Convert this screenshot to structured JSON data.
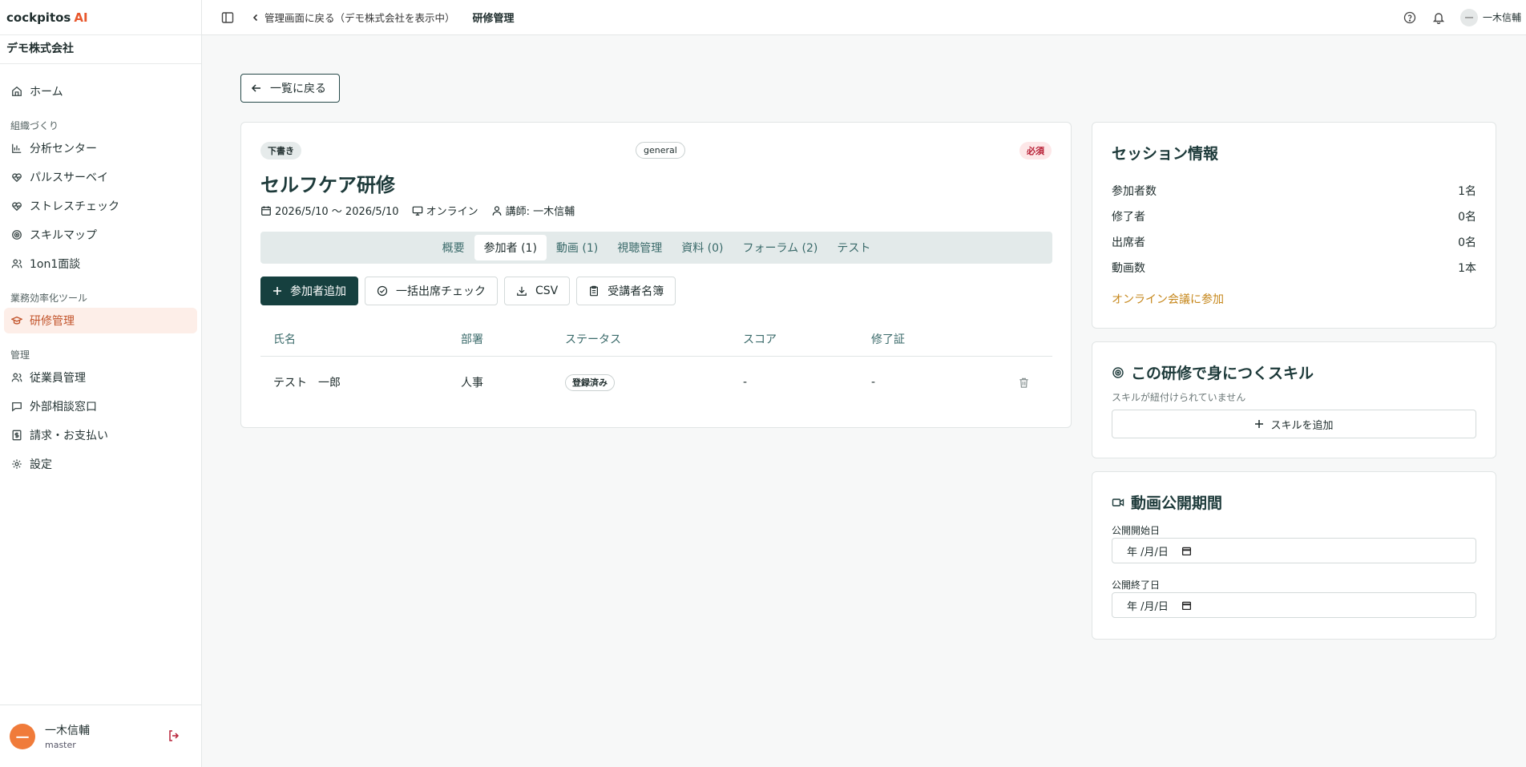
{
  "brand": {
    "name": "cockpitos",
    "suffix": "AI"
  },
  "company": "デモ株式会社",
  "sidebar": {
    "home": "ホーム",
    "section1": "組織づくり",
    "org_items": [
      "分析センター",
      "パルスサーベイ",
      "ストレスチェック",
      "スキルマップ",
      "1on1面談"
    ],
    "section2": "業務効率化ツール",
    "tools_items": [
      "研修管理"
    ],
    "section3": "管理",
    "admin_items": [
      "従業員管理",
      "外部相談窓口",
      "請求・お支払い",
      "設定"
    ]
  },
  "user": {
    "initial": "一",
    "name": "一木信輔",
    "role": "master"
  },
  "topbar": {
    "back_label": "管理画面に戻る（デモ株式会社を表示中）",
    "title": "研修管理",
    "user_initial": "一",
    "user_name": "一木信輔"
  },
  "back_button": "一覧に戻る",
  "course": {
    "status_badge": "下書き",
    "category": "general",
    "required_badge": "必須",
    "title": "セルフケア研修",
    "date_range": "2026/5/10 〜 2026/5/10",
    "mode": "オンライン",
    "instructor": "講師: 一木信輔"
  },
  "tabs": [
    "概要",
    "参加者 (1)",
    "動画 (1)",
    "視聴管理",
    "資料 (0)",
    "フォーラム (2)",
    "テスト"
  ],
  "actions": {
    "add": "参加者追加",
    "bulk": "一括出席チェック",
    "csv": "CSV",
    "roster": "受講者名簿"
  },
  "table": {
    "headers": [
      "氏名",
      "部署",
      "ステータス",
      "スコア",
      "修了証"
    ],
    "rows": [
      {
        "name": "テスト　一郎",
        "dept": "人事",
        "status": "登録済み",
        "score": "-",
        "cert": "-"
      }
    ]
  },
  "session": {
    "title": "セッション情報",
    "items": [
      {
        "label": "参加者数",
        "value": "1名"
      },
      {
        "label": "修了者",
        "value": "0名"
      },
      {
        "label": "出席者",
        "value": "0名"
      },
      {
        "label": "動画数",
        "value": "1本"
      }
    ],
    "join_link": "オンライン会議に参加"
  },
  "skills": {
    "title": "この研修で身につくスキル",
    "empty": "スキルが紐付けられていません",
    "add": "スキルを追加"
  },
  "video_period": {
    "title": "動画公開期間",
    "start_label": "公開開始日",
    "end_label": "公開終了日",
    "placeholder": "年 /月/日"
  },
  "colors": {
    "accent": "#16403f",
    "brand_orange": "#e8572c",
    "active_bg": "#fdeee8",
    "required": "#b61d33",
    "link": "#c6871b"
  }
}
